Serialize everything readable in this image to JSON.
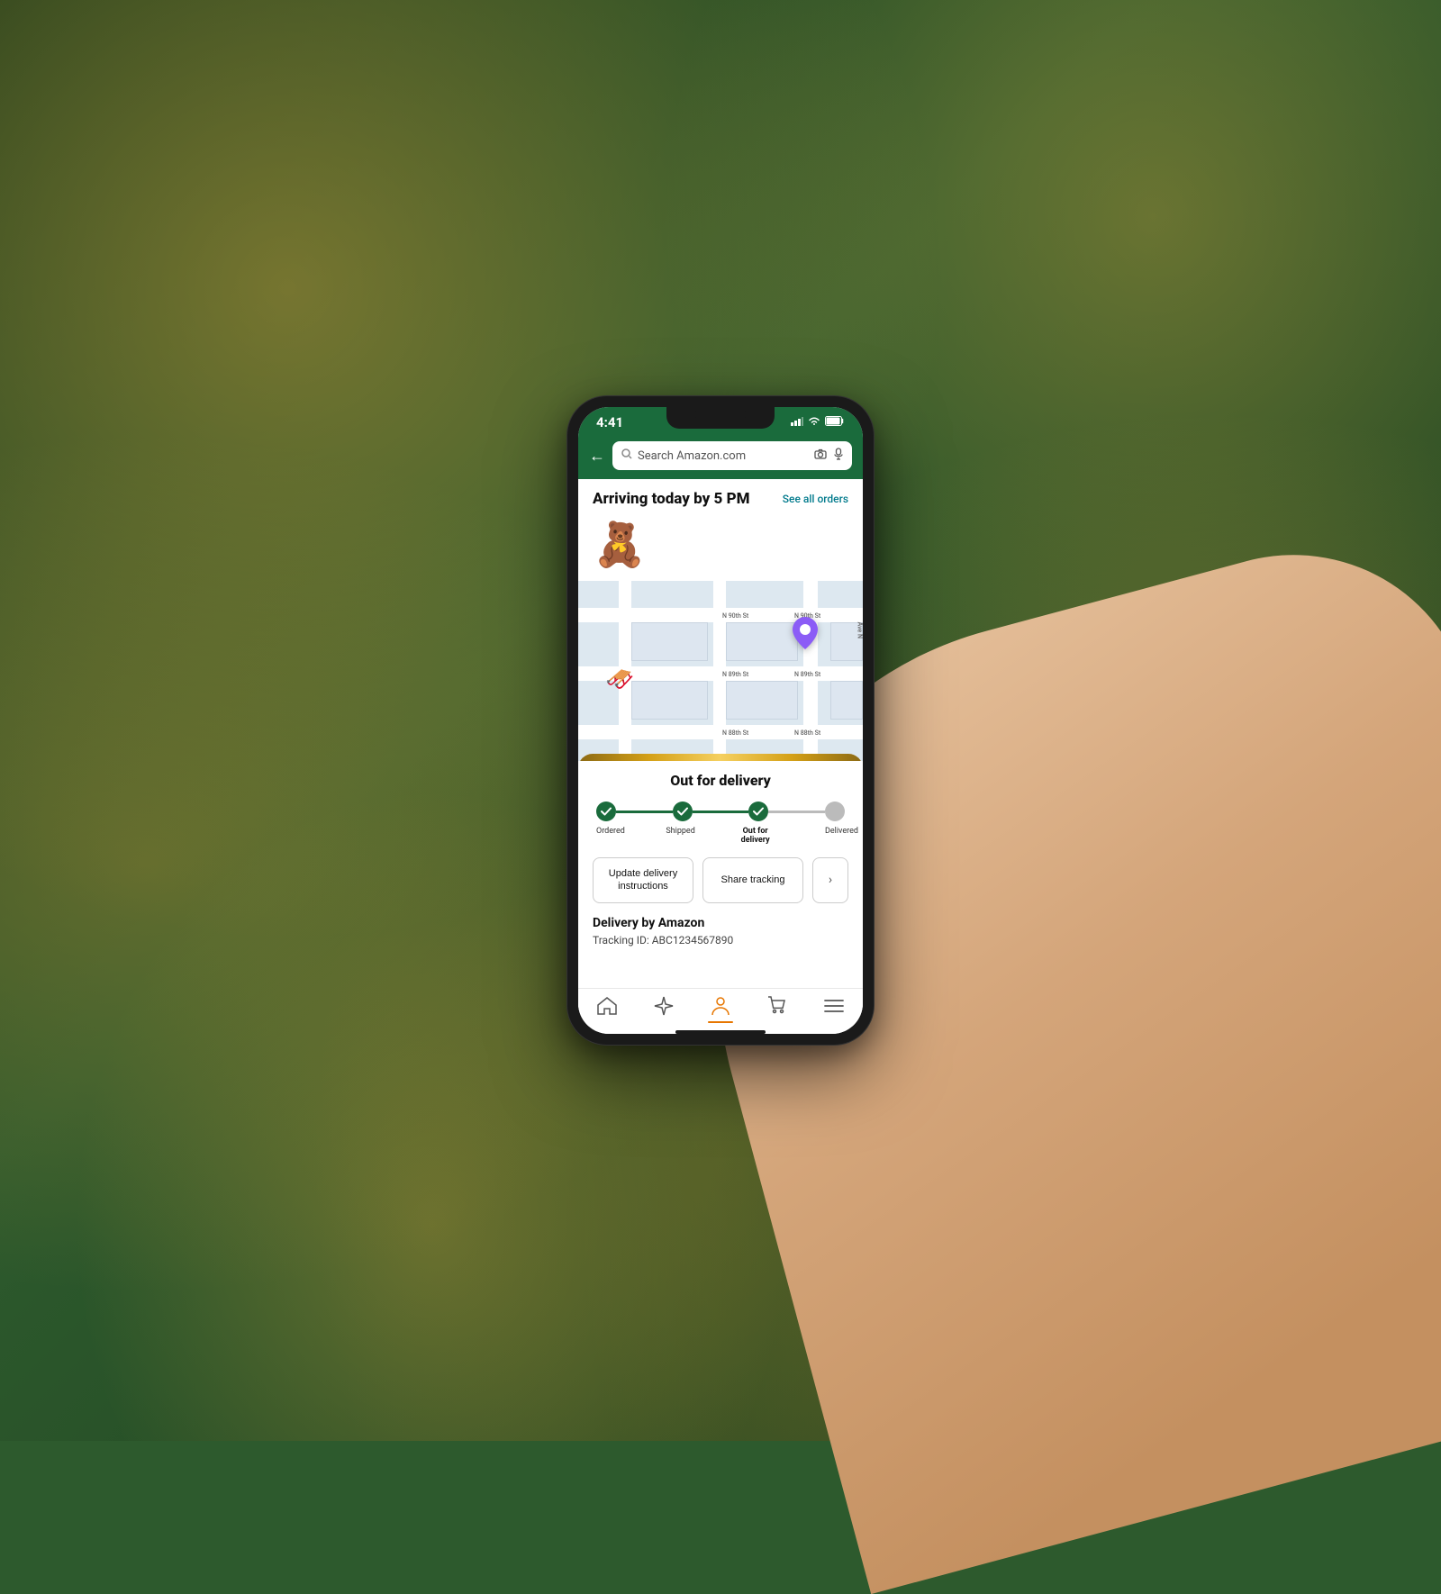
{
  "background": {
    "color": "#2d5a2d"
  },
  "phone": {
    "status_bar": {
      "time": "4:41",
      "signal": "▲▲▲",
      "wifi": "wifi",
      "battery": "battery"
    },
    "search_bar": {
      "placeholder": "Search Amazon.com",
      "back_label": "←"
    },
    "arriving": {
      "title": "Arriving today by 5 PM",
      "see_all_label": "See all orders"
    },
    "product": {
      "emoji": "🧸"
    },
    "map": {
      "street1": "N 90th St",
      "street2": "N 89th St",
      "street3": "N 88th St",
      "avenue": "Ave N",
      "sleigh_emoji": "🛷",
      "pin_emoji": "📍"
    },
    "delivery_card": {
      "title": "Out for delivery",
      "steps": [
        {
          "label": "Ordered",
          "state": "done"
        },
        {
          "label": "Shipped",
          "state": "done"
        },
        {
          "label": "Out for\ndelivery",
          "state": "done",
          "bold": true
        },
        {
          "label": "Delivered",
          "state": "todo"
        }
      ],
      "action_buttons": [
        {
          "label": "Update delivery instructions",
          "id": "update-delivery-btn"
        },
        {
          "label": "Share tracking",
          "id": "share-tracking-btn"
        }
      ],
      "delivery_by": "Delivery by Amazon",
      "tracking_label": "Tracking ID: ABC1234567890"
    },
    "bottom_nav": [
      {
        "icon": "🏠",
        "label": "home",
        "active": false
      },
      {
        "icon": "✦",
        "label": "spark",
        "active": false
      },
      {
        "icon": "👤",
        "label": "account",
        "active": true
      },
      {
        "icon": "🛒",
        "label": "cart",
        "active": false
      },
      {
        "icon": "☰",
        "label": "menu",
        "active": false
      }
    ]
  }
}
